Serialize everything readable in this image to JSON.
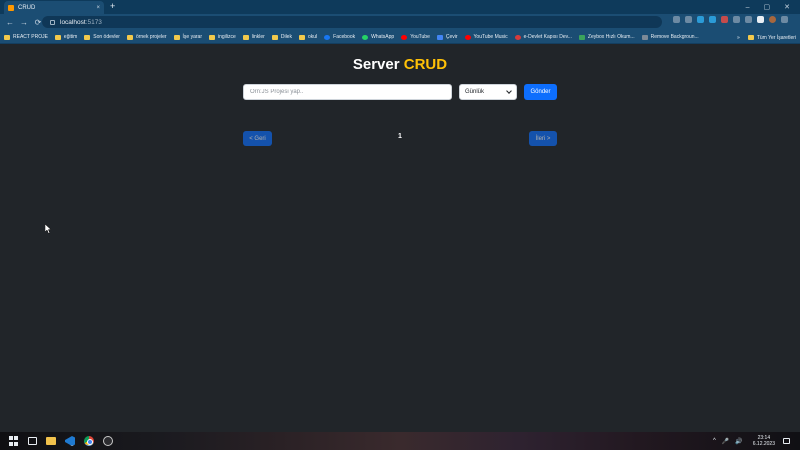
{
  "browser": {
    "tab_title": "CRUD",
    "tab_close": "×",
    "new_tab": "+",
    "url_host": "localhost",
    "url_port": ":5173",
    "nav": {
      "back": "←",
      "forward": "→",
      "reload": "⟳"
    },
    "window_controls": {
      "minimize": "–",
      "maximize": "▢",
      "close": "✕"
    },
    "bookmarks": [
      "REACT PROJE",
      "eğitim",
      "Son ödevler",
      "örnek projeler",
      "İşe yarar",
      "ingilizce",
      "linkler",
      "Dilek",
      "okul",
      "Facebook",
      "WhatsApp",
      "YouTube",
      "Çevir",
      "YouTube Music",
      "e-Devlet Kapısı Dev...",
      "Zeybox Hızlı Okum...",
      "Remove Backgroun..."
    ],
    "bookmarks_more": "»",
    "other_bookmarks": "Tüm Yer İşaretleri"
  },
  "app": {
    "title_main": "Server",
    "title_accent": "CRUD",
    "input_placeholder": "Örn:JS Projesi yap..",
    "select_value": "Günlük",
    "submit_label": "Gönder",
    "prev_label": "< Geri",
    "page_number": "1",
    "next_label": "İleri >"
  },
  "taskbar": {
    "time": "23:14",
    "date": "6.12.2023",
    "tray_up": "^",
    "mic": "🎤",
    "volume": "🔊"
  },
  "colors": {
    "accent": "#ffc107",
    "primary": "#0d6efd",
    "background": "#212529"
  }
}
